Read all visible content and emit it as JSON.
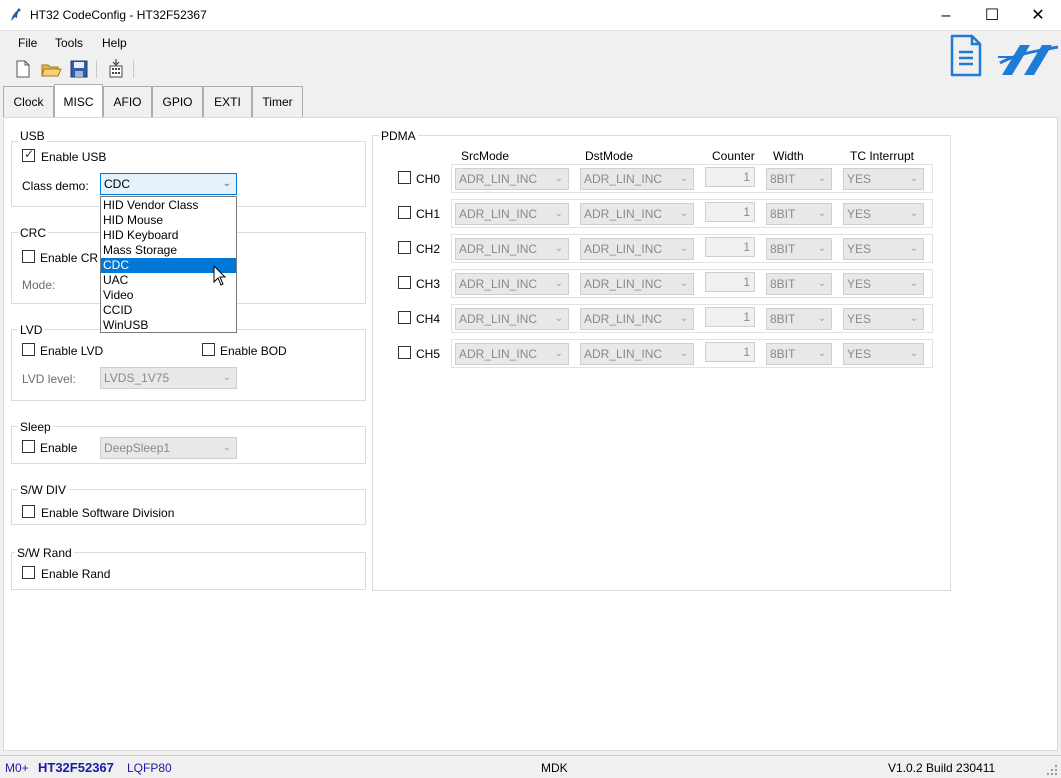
{
  "window": {
    "title": "HT32 CodeConfig - HT32F52367",
    "controls": {
      "minimize": "–",
      "maximize": "☐",
      "close": "✕"
    }
  },
  "menu": [
    "File",
    "Tools",
    "Help"
  ],
  "toolbar": {
    "icons": [
      "new-file-icon",
      "open-folder-icon",
      "save-icon",
      "generate-code-icon"
    ]
  },
  "logo": {
    "icons": [
      "document-icon",
      "holtek-logo-icon"
    ],
    "accent": "#1e7bd6"
  },
  "tabs": [
    "Clock",
    "MISC",
    "AFIO",
    "GPIO",
    "EXTI",
    "Timer"
  ],
  "active_tab": "MISC",
  "usb": {
    "group_title": "USB",
    "enable_label": "Enable USB",
    "enable_checked": true,
    "class_label": "Class demo:",
    "class_value": "CDC",
    "options": [
      "HID Vendor Class",
      "HID Mouse",
      "HID Keyboard",
      "Mass Storage",
      "CDC",
      "UAC",
      "Video",
      "CCID",
      "WinUSB"
    ],
    "selected_option": "CDC"
  },
  "crc": {
    "group_title": "CRC",
    "enable_label": "Enable CR",
    "mode_label": "Mode:"
  },
  "lvd": {
    "group_title": "LVD",
    "enable_lvd_label": "Enable LVD",
    "enable_bod_label": "Enable BOD",
    "level_label": "LVD level:",
    "level_value": "LVDS_1V75"
  },
  "sleep": {
    "group_title": "Sleep",
    "enable_label": "Enable",
    "mode_value": "DeepSleep1"
  },
  "swdiv": {
    "group_title": "S/W DIV",
    "enable_label": "Enable Software Division"
  },
  "swrand": {
    "group_title": "S/W Rand",
    "enable_label": "Enable Rand"
  },
  "pdma": {
    "group_title": "PDMA",
    "headers": {
      "src": "SrcMode",
      "dst": "DstMode",
      "counter": "Counter",
      "width": "Width",
      "tc": "TC Interrupt"
    },
    "channels": [
      {
        "name": "CH0",
        "src": "ADR_LIN_INC",
        "dst": "ADR_LIN_INC",
        "counter": "1",
        "width": "8BIT",
        "tc": "YES"
      },
      {
        "name": "CH1",
        "src": "ADR_LIN_INC",
        "dst": "ADR_LIN_INC",
        "counter": "1",
        "width": "8BIT",
        "tc": "YES"
      },
      {
        "name": "CH2",
        "src": "ADR_LIN_INC",
        "dst": "ADR_LIN_INC",
        "counter": "1",
        "width": "8BIT",
        "tc": "YES"
      },
      {
        "name": "CH3",
        "src": "ADR_LIN_INC",
        "dst": "ADR_LIN_INC",
        "counter": "1",
        "width": "8BIT",
        "tc": "YES"
      },
      {
        "name": "CH4",
        "src": "ADR_LIN_INC",
        "dst": "ADR_LIN_INC",
        "counter": "1",
        "width": "8BIT",
        "tc": "YES"
      },
      {
        "name": "CH5",
        "src": "ADR_LIN_INC",
        "dst": "ADR_LIN_INC",
        "counter": "1",
        "width": "8BIT",
        "tc": "YES"
      }
    ]
  },
  "status": {
    "core": "M0+",
    "chip": "HT32F52367",
    "package": "LQFP80",
    "toolchain": "MDK",
    "version": "V1.0.2 Build 230411",
    "accent": "#1a1aa6"
  }
}
